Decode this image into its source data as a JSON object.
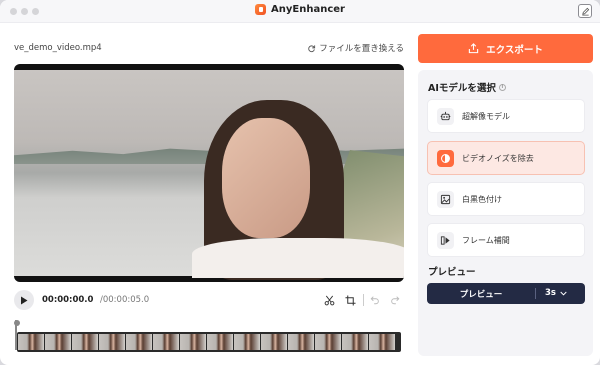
{
  "app": {
    "title": "AnyEnhancer"
  },
  "file": {
    "name": "ve_demo_video.mp4",
    "replace_label": "ファイルを置き換える"
  },
  "player": {
    "time_current": "00:00:00.0",
    "time_total": "/00:00:05.0",
    "frame_count": 14
  },
  "export": {
    "label": "エクスポート"
  },
  "models": {
    "title": "AIモデルを選択",
    "items": [
      {
        "label": "超解像モデル",
        "icon": "robot-icon",
        "active": false
      },
      {
        "label": "ビデオノイズを除去",
        "icon": "denoise-icon",
        "active": true
      },
      {
        "label": "白黒色付け",
        "icon": "colorize-icon",
        "active": false
      },
      {
        "label": "フレーム補間",
        "icon": "frame-interpolation-icon",
        "active": false
      }
    ]
  },
  "preview": {
    "title": "プレビュー",
    "button_label": "プレビュー",
    "duration": "3s"
  },
  "colors": {
    "accent": "#ff6a3d",
    "active_bg": "#fde8e3",
    "preview_bar": "#232a44"
  }
}
